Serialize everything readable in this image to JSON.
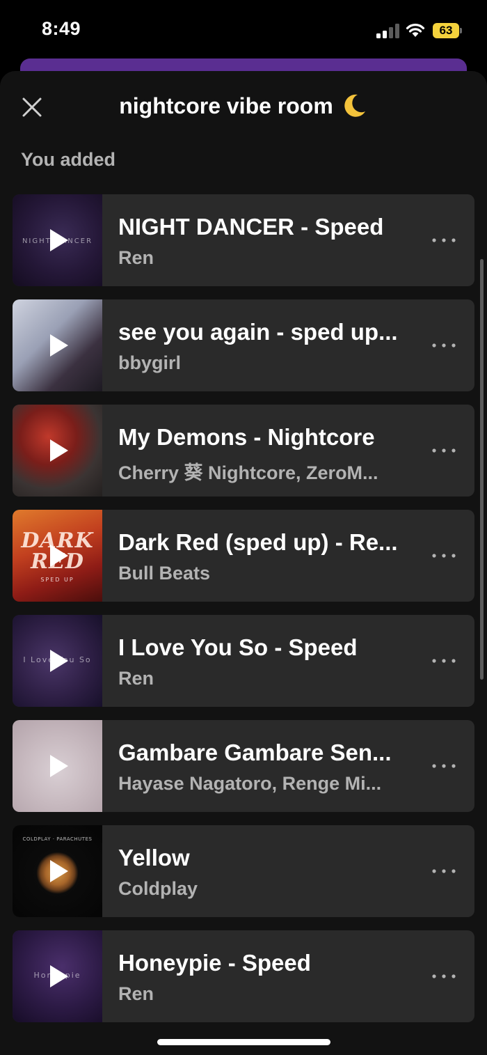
{
  "status_bar": {
    "time": "8:49",
    "battery_level": "63",
    "battery_color": "#f4d23c",
    "signal_icon": "cellular-signal-icon",
    "wifi_icon": "wifi-icon"
  },
  "sheet": {
    "title": "nightcore vibe room",
    "title_emoji_icon": "crescent-moon-icon",
    "close_icon": "close-icon",
    "section_label": "You added",
    "background_color": "#121212",
    "card_color": "#2a2a2a",
    "accent_strip_color": "#5a2e91"
  },
  "tracks": [
    {
      "title": "NIGHT DANCER - Speed",
      "artist": "Ren",
      "cover_text": "NIGHT DANCER"
    },
    {
      "title": "see you again - sped up...",
      "artist": "bbygirl"
    },
    {
      "title": "My Demons - Nightcore",
      "artist": "Cherry 葵 Nightcore, ZeroM..."
    },
    {
      "title": "Dark Red (sped up) - Re...",
      "artist": "Bull Beats",
      "cover_text": "DARK RED",
      "cover_subtext": "SPED UP"
    },
    {
      "title": "I Love You So - Speed",
      "artist": "Ren",
      "cover_text": "I Love You So"
    },
    {
      "title": "Gambare Gambare Sen...",
      "artist": "Hayase Nagatoro, Renge Mi..."
    },
    {
      "title": "Yellow",
      "artist": "Coldplay",
      "cover_text": "COLDPLAY · PARACHUTES"
    },
    {
      "title": "Honeypie - Speed",
      "artist": "Ren",
      "cover_text": "Honeypie"
    }
  ]
}
